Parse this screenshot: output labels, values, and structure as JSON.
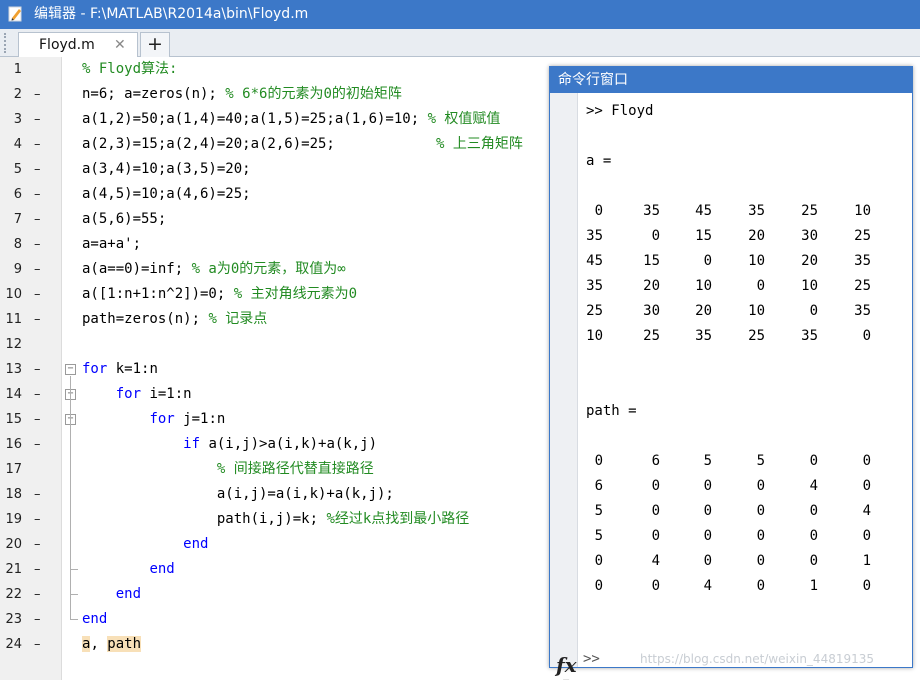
{
  "window": {
    "title": "编辑器 - F:\\MATLAB\\R2014a\\bin\\Floyd.m"
  },
  "tabs": {
    "file_label": "Floyd.m",
    "close_glyph": "✕",
    "add_glyph": "+"
  },
  "editor": {
    "lines": [
      {
        "num": "1",
        "dash": "",
        "parts": [
          {
            "t": "% Floyd算法:",
            "c": "cm"
          }
        ]
      },
      {
        "num": "2",
        "dash": "–",
        "parts": [
          {
            "t": "n=6; a=zeros(n); ",
            "c": ""
          },
          {
            "t": "% 6*6的元素为0的初始矩阵",
            "c": "cm"
          }
        ]
      },
      {
        "num": "3",
        "dash": "–",
        "parts": [
          {
            "t": "a(1,2)=50;a(1,4)=40;a(1,5)=25;a(1,6)=10; ",
            "c": ""
          },
          {
            "t": "% 权值赋值",
            "c": "cm"
          }
        ]
      },
      {
        "num": "4",
        "dash": "–",
        "parts": [
          {
            "t": "a(2,3)=15;a(2,4)=20;a(2,6)=25;            ",
            "c": ""
          },
          {
            "t": "% 上三角矩阵",
            "c": "cm"
          }
        ]
      },
      {
        "num": "5",
        "dash": "–",
        "parts": [
          {
            "t": "a(3,4)=10;a(3,5)=20;",
            "c": ""
          }
        ]
      },
      {
        "num": "6",
        "dash": "–",
        "parts": [
          {
            "t": "a(4,5)=10;a(4,6)=25;",
            "c": ""
          }
        ]
      },
      {
        "num": "7",
        "dash": "–",
        "parts": [
          {
            "t": "a(5,6)=55;",
            "c": ""
          }
        ]
      },
      {
        "num": "8",
        "dash": "–",
        "parts": [
          {
            "t": "a=a+a';",
            "c": ""
          }
        ]
      },
      {
        "num": "9",
        "dash": "–",
        "parts": [
          {
            "t": "a(a==0)=inf; ",
            "c": ""
          },
          {
            "t": "% a为0的元素，取值为∞",
            "c": "cm"
          }
        ]
      },
      {
        "num": "10",
        "dash": "–",
        "parts": [
          {
            "t": "a([1:n+1:n^2])=0; ",
            "c": ""
          },
          {
            "t": "% 主对角线元素为0",
            "c": "cm"
          }
        ]
      },
      {
        "num": "11",
        "dash": "–",
        "parts": [
          {
            "t": "path=zeros(n); ",
            "c": ""
          },
          {
            "t": "% 记录点",
            "c": "cm"
          }
        ]
      },
      {
        "num": "12",
        "dash": "",
        "parts": []
      },
      {
        "num": "13",
        "dash": "–",
        "parts": [
          {
            "t": "for",
            "c": "kw"
          },
          {
            "t": " k=1:n",
            "c": ""
          }
        ]
      },
      {
        "num": "14",
        "dash": "–",
        "parts": [
          {
            "t": "    ",
            "c": ""
          },
          {
            "t": "for",
            "c": "kw"
          },
          {
            "t": " i=1:n",
            "c": ""
          }
        ]
      },
      {
        "num": "15",
        "dash": "–",
        "parts": [
          {
            "t": "        ",
            "c": ""
          },
          {
            "t": "for",
            "c": "kw"
          },
          {
            "t": " j=1:n",
            "c": ""
          }
        ]
      },
      {
        "num": "16",
        "dash": "–",
        "parts": [
          {
            "t": "            ",
            "c": ""
          },
          {
            "t": "if",
            "c": "kw"
          },
          {
            "t": " a(i,j)>a(i,k)+a(k,j)",
            "c": ""
          }
        ]
      },
      {
        "num": "17",
        "dash": "",
        "parts": [
          {
            "t": "                ",
            "c": ""
          },
          {
            "t": "% 间接路径代替直接路径",
            "c": "cm"
          }
        ]
      },
      {
        "num": "18",
        "dash": "–",
        "parts": [
          {
            "t": "                a(i,j)=a(i,k)+a(k,j);",
            "c": ""
          }
        ]
      },
      {
        "num": "19",
        "dash": "–",
        "parts": [
          {
            "t": "                path(i,j)=k; ",
            "c": ""
          },
          {
            "t": "%经过k点找到最小路径",
            "c": "cm"
          }
        ]
      },
      {
        "num": "20",
        "dash": "–",
        "parts": [
          {
            "t": "            ",
            "c": ""
          },
          {
            "t": "end",
            "c": "kw"
          }
        ]
      },
      {
        "num": "21",
        "dash": "–",
        "parts": [
          {
            "t": "        ",
            "c": ""
          },
          {
            "t": "end",
            "c": "kw"
          }
        ]
      },
      {
        "num": "22",
        "dash": "–",
        "parts": [
          {
            "t": "    ",
            "c": ""
          },
          {
            "t": "end",
            "c": "kw"
          }
        ]
      },
      {
        "num": "23",
        "dash": "–",
        "parts": [
          {
            "t": "end",
            "c": "kw"
          }
        ]
      },
      {
        "num": "24",
        "dash": "–",
        "parts": [
          {
            "t": "a",
            "c": "hl"
          },
          {
            "t": ", ",
            "c": ""
          },
          {
            "t": "path",
            "c": "hl"
          }
        ]
      }
    ]
  },
  "command_window": {
    "title": "命令行窗口",
    "command": ">> Floyd",
    "a_label": "a =",
    "a_matrix": [
      [
        0,
        35,
        45,
        35,
        25,
        10
      ],
      [
        35,
        0,
        15,
        20,
        30,
        25
      ],
      [
        45,
        15,
        0,
        10,
        20,
        35
      ],
      [
        35,
        20,
        10,
        0,
        10,
        25
      ],
      [
        25,
        30,
        20,
        10,
        0,
        35
      ],
      [
        10,
        25,
        35,
        25,
        35,
        0
      ]
    ],
    "path_label": "path =",
    "path_matrix": [
      [
        0,
        6,
        5,
        5,
        0,
        0
      ],
      [
        6,
        0,
        0,
        0,
        4,
        0
      ],
      [
        5,
        0,
        0,
        0,
        0,
        4
      ],
      [
        5,
        0,
        0,
        0,
        0,
        0
      ],
      [
        0,
        4,
        0,
        0,
        0,
        1
      ],
      [
        0,
        0,
        4,
        0,
        1,
        0
      ]
    ],
    "fx_label": "fx",
    "prompt": ">>"
  },
  "watermark": "https://blog.csdn.net/weixin_44819135"
}
